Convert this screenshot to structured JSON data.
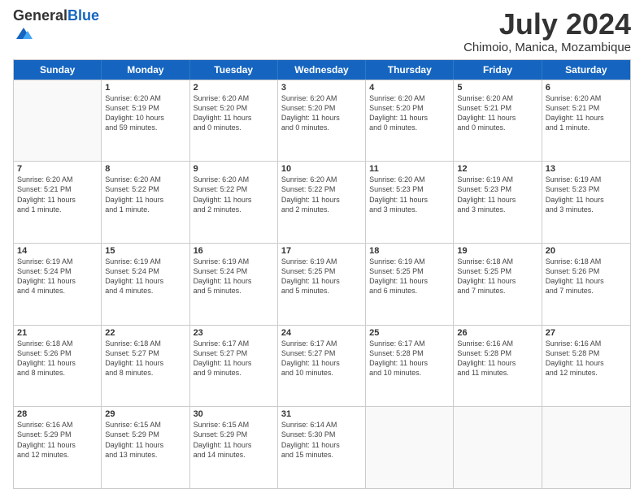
{
  "logo": {
    "general": "General",
    "blue": "Blue"
  },
  "title": "July 2024",
  "subtitle": "Chimoio, Manica, Mozambique",
  "headers": [
    "Sunday",
    "Monday",
    "Tuesday",
    "Wednesday",
    "Thursday",
    "Friday",
    "Saturday"
  ],
  "weeks": [
    [
      {
        "day": "",
        "info": "",
        "empty": true
      },
      {
        "day": "1",
        "info": "Sunrise: 6:20 AM\nSunset: 5:19 PM\nDaylight: 10 hours\nand 59 minutes."
      },
      {
        "day": "2",
        "info": "Sunrise: 6:20 AM\nSunset: 5:20 PM\nDaylight: 11 hours\nand 0 minutes."
      },
      {
        "day": "3",
        "info": "Sunrise: 6:20 AM\nSunset: 5:20 PM\nDaylight: 11 hours\nand 0 minutes."
      },
      {
        "day": "4",
        "info": "Sunrise: 6:20 AM\nSunset: 5:20 PM\nDaylight: 11 hours\nand 0 minutes."
      },
      {
        "day": "5",
        "info": "Sunrise: 6:20 AM\nSunset: 5:21 PM\nDaylight: 11 hours\nand 0 minutes."
      },
      {
        "day": "6",
        "info": "Sunrise: 6:20 AM\nSunset: 5:21 PM\nDaylight: 11 hours\nand 1 minute."
      }
    ],
    [
      {
        "day": "7",
        "info": "Sunrise: 6:20 AM\nSunset: 5:21 PM\nDaylight: 11 hours\nand 1 minute."
      },
      {
        "day": "8",
        "info": "Sunrise: 6:20 AM\nSunset: 5:22 PM\nDaylight: 11 hours\nand 1 minute."
      },
      {
        "day": "9",
        "info": "Sunrise: 6:20 AM\nSunset: 5:22 PM\nDaylight: 11 hours\nand 2 minutes."
      },
      {
        "day": "10",
        "info": "Sunrise: 6:20 AM\nSunset: 5:22 PM\nDaylight: 11 hours\nand 2 minutes."
      },
      {
        "day": "11",
        "info": "Sunrise: 6:20 AM\nSunset: 5:23 PM\nDaylight: 11 hours\nand 3 minutes."
      },
      {
        "day": "12",
        "info": "Sunrise: 6:19 AM\nSunset: 5:23 PM\nDaylight: 11 hours\nand 3 minutes."
      },
      {
        "day": "13",
        "info": "Sunrise: 6:19 AM\nSunset: 5:23 PM\nDaylight: 11 hours\nand 3 minutes."
      }
    ],
    [
      {
        "day": "14",
        "info": "Sunrise: 6:19 AM\nSunset: 5:24 PM\nDaylight: 11 hours\nand 4 minutes."
      },
      {
        "day": "15",
        "info": "Sunrise: 6:19 AM\nSunset: 5:24 PM\nDaylight: 11 hours\nand 4 minutes."
      },
      {
        "day": "16",
        "info": "Sunrise: 6:19 AM\nSunset: 5:24 PM\nDaylight: 11 hours\nand 5 minutes."
      },
      {
        "day": "17",
        "info": "Sunrise: 6:19 AM\nSunset: 5:25 PM\nDaylight: 11 hours\nand 5 minutes."
      },
      {
        "day": "18",
        "info": "Sunrise: 6:19 AM\nSunset: 5:25 PM\nDaylight: 11 hours\nand 6 minutes."
      },
      {
        "day": "19",
        "info": "Sunrise: 6:18 AM\nSunset: 5:25 PM\nDaylight: 11 hours\nand 7 minutes."
      },
      {
        "day": "20",
        "info": "Sunrise: 6:18 AM\nSunset: 5:26 PM\nDaylight: 11 hours\nand 7 minutes."
      }
    ],
    [
      {
        "day": "21",
        "info": "Sunrise: 6:18 AM\nSunset: 5:26 PM\nDaylight: 11 hours\nand 8 minutes."
      },
      {
        "day": "22",
        "info": "Sunrise: 6:18 AM\nSunset: 5:27 PM\nDaylight: 11 hours\nand 8 minutes."
      },
      {
        "day": "23",
        "info": "Sunrise: 6:17 AM\nSunset: 5:27 PM\nDaylight: 11 hours\nand 9 minutes."
      },
      {
        "day": "24",
        "info": "Sunrise: 6:17 AM\nSunset: 5:27 PM\nDaylight: 11 hours\nand 10 minutes."
      },
      {
        "day": "25",
        "info": "Sunrise: 6:17 AM\nSunset: 5:28 PM\nDaylight: 11 hours\nand 10 minutes."
      },
      {
        "day": "26",
        "info": "Sunrise: 6:16 AM\nSunset: 5:28 PM\nDaylight: 11 hours\nand 11 minutes."
      },
      {
        "day": "27",
        "info": "Sunrise: 6:16 AM\nSunset: 5:28 PM\nDaylight: 11 hours\nand 12 minutes."
      }
    ],
    [
      {
        "day": "28",
        "info": "Sunrise: 6:16 AM\nSunset: 5:29 PM\nDaylight: 11 hours\nand 12 minutes."
      },
      {
        "day": "29",
        "info": "Sunrise: 6:15 AM\nSunset: 5:29 PM\nDaylight: 11 hours\nand 13 minutes."
      },
      {
        "day": "30",
        "info": "Sunrise: 6:15 AM\nSunset: 5:29 PM\nDaylight: 11 hours\nand 14 minutes."
      },
      {
        "day": "31",
        "info": "Sunrise: 6:14 AM\nSunset: 5:30 PM\nDaylight: 11 hours\nand 15 minutes."
      },
      {
        "day": "",
        "info": "",
        "empty": true
      },
      {
        "day": "",
        "info": "",
        "empty": true
      },
      {
        "day": "",
        "info": "",
        "empty": true
      }
    ]
  ]
}
